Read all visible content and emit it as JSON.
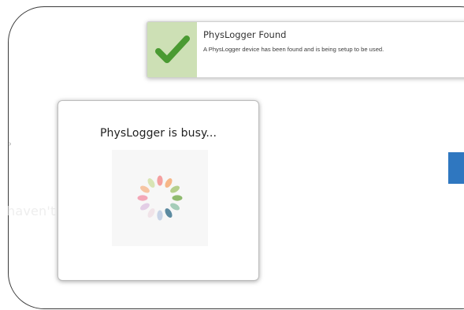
{
  "background": {
    "empty_state_text": "haven't added any workspace yet.",
    "left_glyph": "›",
    "side_button_color": "#2f77c0"
  },
  "toast": {
    "title": "PhysLogger Found",
    "message": "A PhysLogger device has been found and is being setup to be used.",
    "icon": "checkmark-icon",
    "icon_bg_color": "#cde0b5",
    "icon_color": "#4a9a32"
  },
  "busy_dialog": {
    "title": "PhysLogger is busy...",
    "spinner_icon": "loading-spinner-icon",
    "spinner_colors": [
      "#f4a0a0",
      "#f6b788",
      "#b5cf8c",
      "#8fba6f",
      "#a5cdb9",
      "#5b8aa0",
      "#c7d3e6",
      "#f0e3e8",
      "#e3cee6",
      "#f3a7b8",
      "#f6c4a2",
      "#d8e4b4"
    ]
  }
}
